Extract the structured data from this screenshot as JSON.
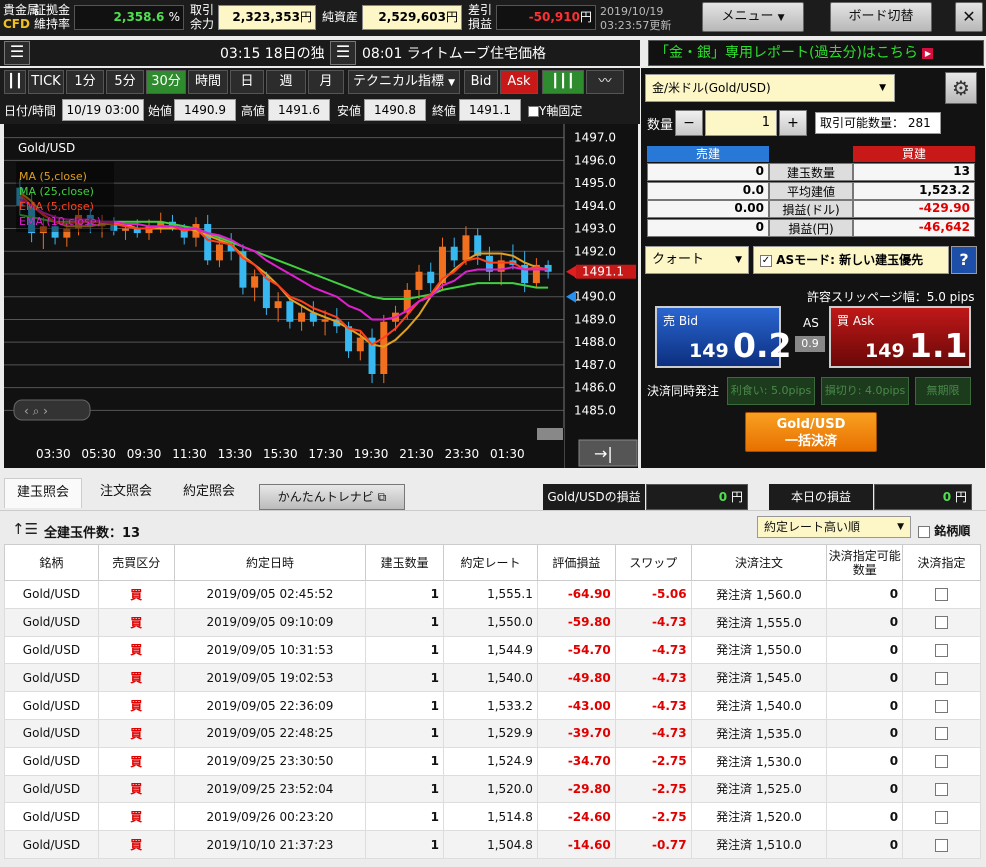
{
  "topbar": {
    "product_label_1": "貴金属",
    "product_label_2": "CFD",
    "margin_label_1": "証拠金",
    "margin_label_2": "維持率",
    "margin_value": "2,358.6",
    "margin_unit": "%",
    "available_label_1": "取引",
    "available_label_2": "余力",
    "available_value": "2,323,353",
    "available_unit": "円",
    "net_label": "純資産",
    "net_value": "2,529,603",
    "net_unit": "円",
    "pl_label_1": "差引",
    "pl_label_2": "損益",
    "pl_value": "-50,910",
    "pl_unit": "円",
    "date": "2019/10/19",
    "updated": "03:23:57更新",
    "menu_label": "メニュー",
    "board_label": "ボード切替",
    "close_label": "✕"
  },
  "ticker": {
    "news_1": "03:15 18日の独",
    "news_2": "08:01 ライトムーブ住宅価格",
    "report": "「金・銀」専用レポート(過去分)はこちら"
  },
  "chart_toolbar": {
    "timeframes": [
      "TICK",
      "1分",
      "5分",
      "30分",
      "時間",
      "日",
      "週",
      "月"
    ],
    "selected": "30分",
    "indicator_label": "テクニカル指標",
    "bid_label": "Bid",
    "ask_label": "Ask"
  },
  "ohlc": {
    "datetime_label": "日付/時間",
    "datetime_value": "10/19 03:00",
    "open_label": "始値",
    "open_value": "1490.9",
    "high_label": "高値",
    "high_value": "1491.6",
    "low_label": "安値",
    "low_value": "1490.8",
    "close_label": "終値",
    "close_value": "1491.1",
    "yfix_label": "Y軸固定"
  },
  "chart_data": {
    "type": "line",
    "title": "Gold/USD",
    "legend": [
      "MA (5,close)",
      "MA (25,close)",
      "EMA (5,close)",
      "EMA (10,close)"
    ],
    "legend_colors": [
      "#e0a020",
      "#40d040",
      "#ff4020",
      "#e020d0"
    ],
    "x_ticks": [
      "03:30",
      "05:30",
      "09:30",
      "11:30",
      "13:30",
      "15:30",
      "17:30",
      "19:30",
      "21:30",
      "23:30",
      "01:30"
    ],
    "y_ticks": [
      1497.0,
      1496.0,
      1495.0,
      1494.0,
      1493.0,
      1492.0,
      1491.0,
      1490.0,
      1489.0,
      1488.0,
      1487.0,
      1486.0,
      1485.0
    ],
    "y_tick_labels": [
      "1497.0",
      "1496.0",
      "1495.0",
      "1494.0",
      "1493.0",
      "1492.0",
      "1491.0",
      "1490.0",
      "1489.0",
      "1488.0",
      "1487.0",
      "1486.0",
      "1485.0"
    ],
    "ylim": [
      1484.4,
      1497.6
    ],
    "current_price": 1491.1,
    "current_price_label": "1491.1",
    "candles": [
      [
        1494.8,
        1495.2,
        1493.6,
        1494.0
      ],
      [
        1494.0,
        1494.6,
        1492.4,
        1492.8
      ],
      [
        1492.8,
        1493.5,
        1492.1,
        1493.1
      ],
      [
        1493.1,
        1493.6,
        1492.3,
        1492.6
      ],
      [
        1492.6,
        1493.4,
        1492.2,
        1493.0
      ],
      [
        1493.0,
        1493.9,
        1492.7,
        1493.6
      ],
      [
        1493.6,
        1493.9,
        1492.8,
        1493.1
      ],
      [
        1493.1,
        1493.6,
        1492.6,
        1493.3
      ],
      [
        1493.3,
        1493.5,
        1492.7,
        1492.9
      ],
      [
        1492.9,
        1493.2,
        1492.5,
        1493.0
      ],
      [
        1493.0,
        1493.4,
        1492.6,
        1492.8
      ],
      [
        1492.8,
        1493.4,
        1492.5,
        1493.1
      ],
      [
        1493.1,
        1493.7,
        1492.8,
        1493.3
      ],
      [
        1493.3,
        1493.6,
        1492.9,
        1493.0
      ],
      [
        1493.0,
        1493.2,
        1492.3,
        1492.6
      ],
      [
        1492.6,
        1493.5,
        1492.2,
        1493.2
      ],
      [
        1493.2,
        1493.6,
        1491.4,
        1491.6
      ],
      [
        1491.6,
        1492.6,
        1491.3,
        1492.3
      ],
      [
        1492.3,
        1492.8,
        1491.6,
        1492.0
      ],
      [
        1492.0,
        1492.3,
        1490.1,
        1490.4
      ],
      [
        1490.4,
        1491.2,
        1489.8,
        1490.9
      ],
      [
        1490.9,
        1491.1,
        1489.2,
        1489.5
      ],
      [
        1489.5,
        1490.2,
        1488.9,
        1489.8
      ],
      [
        1489.8,
        1490.0,
        1488.6,
        1488.9
      ],
      [
        1488.9,
        1489.6,
        1488.5,
        1489.3
      ],
      [
        1489.3,
        1489.8,
        1488.7,
        1488.9
      ],
      [
        1488.9,
        1489.4,
        1488.3,
        1489.0
      ],
      [
        1489.0,
        1489.5,
        1488.4,
        1488.7
      ],
      [
        1488.7,
        1488.9,
        1487.3,
        1487.6
      ],
      [
        1487.6,
        1488.5,
        1487.2,
        1488.2
      ],
      [
        1488.2,
        1488.6,
        1486.2,
        1486.6
      ],
      [
        1486.6,
        1489.2,
        1486.2,
        1488.9
      ],
      [
        1488.9,
        1489.6,
        1488.5,
        1489.3
      ],
      [
        1489.3,
        1490.6,
        1489.0,
        1490.3
      ],
      [
        1490.3,
        1491.4,
        1489.9,
        1491.1
      ],
      [
        1491.1,
        1491.5,
        1490.2,
        1490.6
      ],
      [
        1490.6,
        1492.6,
        1490.3,
        1492.2
      ],
      [
        1492.2,
        1492.6,
        1491.3,
        1491.6
      ],
      [
        1491.6,
        1493.1,
        1491.4,
        1492.7
      ],
      [
        1492.7,
        1493.0,
        1491.4,
        1491.8
      ],
      [
        1491.8,
        1492.2,
        1490.7,
        1491.1
      ],
      [
        1491.1,
        1491.9,
        1490.5,
        1491.6
      ],
      [
        1491.6,
        1492.3,
        1491.2,
        1491.4
      ],
      [
        1491.4,
        1492.0,
        1490.2,
        1490.6
      ],
      [
        1490.6,
        1491.7,
        1490.4,
        1491.4
      ],
      [
        1491.4,
        1491.6,
        1490.8,
        1491.1
      ]
    ],
    "ma5": [
      1494.6,
      1494.2,
      1493.6,
      1493.3,
      1493.1,
      1493.1,
      1493.1,
      1493.2,
      1493.2,
      1493.2,
      1493.0,
      1493.0,
      1493.0,
      1493.0,
      1493.0,
      1492.9,
      1492.7,
      1492.5,
      1492.3,
      1491.8,
      1491.4,
      1491.0,
      1490.5,
      1489.9,
      1489.6,
      1489.3,
      1489.1,
      1488.9,
      1488.6,
      1488.3,
      1487.9,
      1487.8,
      1488.1,
      1488.6,
      1489.2,
      1490.0,
      1490.7,
      1491.2,
      1491.6,
      1491.9,
      1491.9,
      1491.9,
      1491.8,
      1491.5,
      1491.3,
      1491.2
    ],
    "ma25": [
      1493.6,
      1493.5,
      1493.4,
      1493.3,
      1493.3,
      1493.3,
      1493.3,
      1493.3,
      1493.3,
      1493.3,
      1493.3,
      1493.3,
      1493.3,
      1493.2,
      1493.1,
      1493.0,
      1492.8,
      1492.6,
      1492.4,
      1492.2,
      1492.0,
      1491.8,
      1491.6,
      1491.4,
      1491.2,
      1491.0,
      1490.8,
      1490.6,
      1490.4,
      1490.2,
      1490.0,
      1489.9,
      1489.9,
      1489.9,
      1490.0,
      1490.1,
      1490.3,
      1490.4,
      1490.5,
      1490.6,
      1490.6,
      1490.6,
      1490.6,
      1490.5,
      1490.4,
      1490.4
    ],
    "ema5": [
      1494.5,
      1494.0,
      1493.6,
      1493.3,
      1493.2,
      1493.3,
      1493.3,
      1493.3,
      1493.2,
      1493.1,
      1493.0,
      1493.0,
      1493.1,
      1493.1,
      1492.9,
      1493.0,
      1492.5,
      1492.4,
      1492.3,
      1491.7,
      1491.4,
      1490.8,
      1490.5,
      1490.0,
      1489.8,
      1489.5,
      1489.3,
      1489.1,
      1488.6,
      1488.5,
      1487.9,
      1488.2,
      1488.6,
      1489.2,
      1489.8,
      1490.1,
      1490.8,
      1491.1,
      1491.6,
      1491.7,
      1491.5,
      1491.5,
      1491.5,
      1491.2,
      1491.3,
      1491.2
    ],
    "ema10": [
      1494.3,
      1494.0,
      1493.7,
      1493.5,
      1493.4,
      1493.4,
      1493.4,
      1493.3,
      1493.3,
      1493.2,
      1493.2,
      1493.1,
      1493.1,
      1493.1,
      1493.0,
      1493.0,
      1492.8,
      1492.7,
      1492.5,
      1492.2,
      1492.0,
      1491.6,
      1491.3,
      1491.0,
      1490.7,
      1490.4,
      1490.2,
      1490.0,
      1489.6,
      1489.4,
      1489.0,
      1489.0,
      1489.1,
      1489.4,
      1489.8,
      1490.0,
      1490.5,
      1490.7,
      1491.1,
      1491.2,
      1491.2,
      1491.2,
      1491.3,
      1491.2,
      1491.2,
      1491.2
    ]
  },
  "order_panel": {
    "symbol": "金/米ドル(Gold/USD)",
    "qty_label": "数量",
    "qty_value": "1",
    "minus": "−",
    "plus": "+",
    "available_qty_label": "取引可能数量：",
    "available_qty_value": "281",
    "sell_header": "売建",
    "buy_header": "買建",
    "rows": [
      {
        "label": "建玉数量",
        "sell": "0",
        "buy": "13"
      },
      {
        "label": "平均建値",
        "sell": "0.0",
        "buy": "1,523.2"
      },
      {
        "label": "損益(ドル)",
        "sell": "0.00",
        "buy": "-429.90"
      },
      {
        "label": "損益(円)",
        "sell": "0",
        "buy": "-46,642"
      }
    ],
    "order_type": "クォート",
    "as_mode": "ASモード: 新しい建玉優先",
    "help": "?",
    "slippage": "許容スリッページ幅：5.0 pips",
    "bid_label": "売 Bid",
    "bid_big": "149",
    "bid_small": "0.2",
    "spread_label": "AS",
    "spread_value": "0.9",
    "ask_label": "買 Ask",
    "ask_big": "149",
    "ask_small": "1.1",
    "settle_label": "決済同時発注",
    "tp_label": "利食い: 5.0pips",
    "sl_label": "損切り: 4.0pips",
    "unlimited_label": "無期限",
    "bulk_1": "Gold/USD",
    "bulk_2": "一括決済"
  },
  "bottom": {
    "tabs": [
      "建玉照会",
      "注文照会",
      "約定照会"
    ],
    "navi_label": "かんたんトレナビ",
    "pl_label": "Gold/USDの損益",
    "pl_value": "0",
    "pl_unit": "円",
    "today_label": "本日の損益",
    "today_value": "0",
    "today_unit": "円",
    "count_label": "全建玉件数：13",
    "sort_label": "約定レート高い順",
    "symbol_sort": "銘柄順",
    "columns": [
      "銘柄",
      "売買区分",
      "約定日時",
      "建玉数量",
      "約定レート",
      "評価損益",
      "スワップ",
      "決済注文",
      "決済指定可能数量",
      "決済指定"
    ],
    "rows": [
      [
        "Gold/USD",
        "買",
        "2019/09/05 02:45:52",
        "1",
        "1,555.1",
        "-64.90",
        "-5.06",
        "発注済 1,560.0",
        "0"
      ],
      [
        "Gold/USD",
        "買",
        "2019/09/05 09:10:09",
        "1",
        "1,550.0",
        "-59.80",
        "-4.73",
        "発注済 1,555.0",
        "0"
      ],
      [
        "Gold/USD",
        "買",
        "2019/09/05 10:31:53",
        "1",
        "1,544.9",
        "-54.70",
        "-4.73",
        "発注済 1,550.0",
        "0"
      ],
      [
        "Gold/USD",
        "買",
        "2019/09/05 19:02:53",
        "1",
        "1,540.0",
        "-49.80",
        "-4.73",
        "発注済 1,545.0",
        "0"
      ],
      [
        "Gold/USD",
        "買",
        "2019/09/05 22:36:09",
        "1",
        "1,533.2",
        "-43.00",
        "-4.73",
        "発注済 1,540.0",
        "0"
      ],
      [
        "Gold/USD",
        "買",
        "2019/09/05 22:48:25",
        "1",
        "1,529.9",
        "-39.70",
        "-4.73",
        "発注済 1,535.0",
        "0"
      ],
      [
        "Gold/USD",
        "買",
        "2019/09/25 23:30:50",
        "1",
        "1,524.9",
        "-34.70",
        "-2.75",
        "発注済 1,530.0",
        "0"
      ],
      [
        "Gold/USD",
        "買",
        "2019/09/25 23:52:04",
        "1",
        "1,520.0",
        "-29.80",
        "-2.75",
        "発注済 1,525.0",
        "0"
      ],
      [
        "Gold/USD",
        "買",
        "2019/09/26 00:23:20",
        "1",
        "1,514.8",
        "-24.60",
        "-2.75",
        "発注済 1,520.0",
        "0"
      ],
      [
        "Gold/USD",
        "買",
        "2019/10/10 21:37:23",
        "1",
        "1,504.8",
        "-14.60",
        "-0.77",
        "発注済 1,510.0",
        "0"
      ]
    ]
  }
}
